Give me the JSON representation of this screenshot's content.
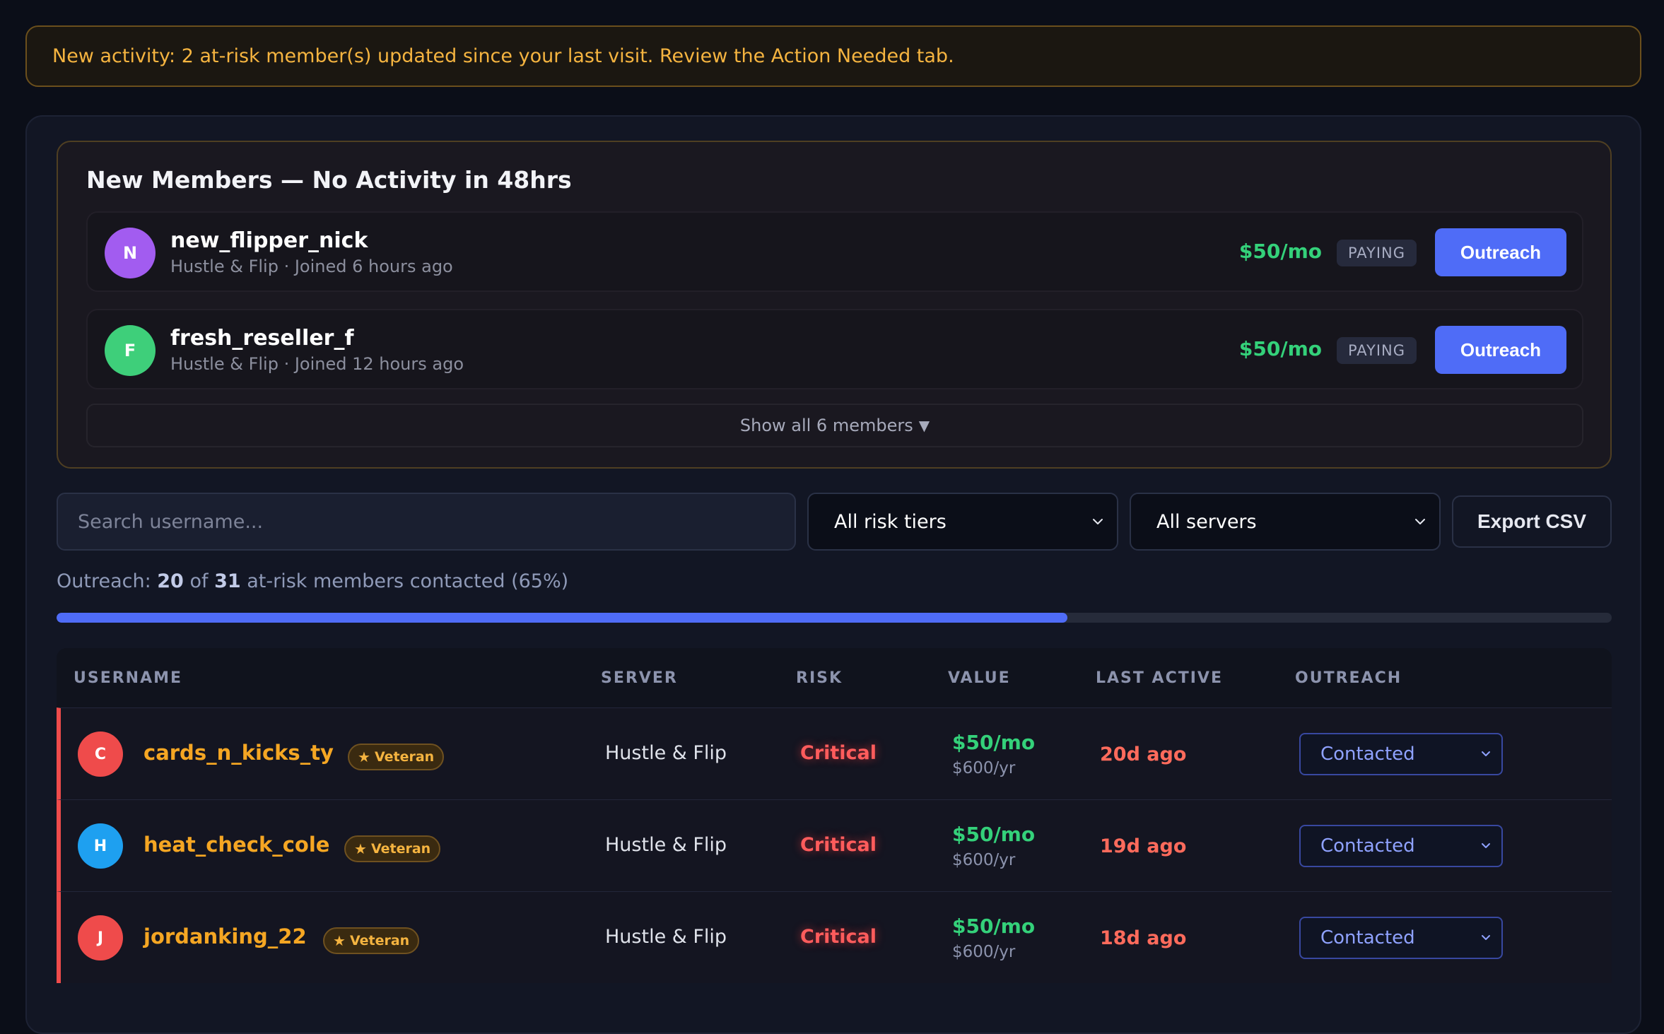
{
  "banner": {
    "text": "New activity: 2 at-risk member(s) updated since your last visit. Review the Action Needed tab."
  },
  "new_members": {
    "title": "New Members — No Activity in 48hrs",
    "members": [
      {
        "initial": "N",
        "avatar_color": "#a25cf0",
        "name": "new_flipper_nick",
        "sub": "Hustle & Flip · Joined 6 hours ago",
        "price": "$50/mo",
        "badge": "PAYING",
        "button": "Outreach"
      },
      {
        "initial": "F",
        "avatar_color": "#3ecf7a",
        "name": "fresh_reseller_f",
        "sub": "Hustle & Flip · Joined 12 hours ago",
        "price": "$50/mo",
        "badge": "PAYING",
        "button": "Outreach"
      }
    ],
    "show_all": "Show all 6 members",
    "show_all_caret": "▼"
  },
  "filters": {
    "search_placeholder": "Search username...",
    "risk_tier": "All risk tiers",
    "server": "All servers",
    "export": "Export CSV"
  },
  "outreach": {
    "prefix": "Outreach:",
    "contacted": "20",
    "of": "of",
    "total": "31",
    "suffix": "at-risk members contacted (65%)",
    "progress_percent": 65
  },
  "table": {
    "headers": {
      "username": "USERNAME",
      "server": "SERVER",
      "risk": "RISK",
      "value": "VALUE",
      "last_active": "LAST ACTIVE",
      "outreach": "OUTREACH"
    },
    "rows": [
      {
        "initial": "C",
        "avatar_color": "#ef4b4b",
        "username": "cards_n_kicks_ty",
        "badge": "Veteran",
        "server": "Hustle & Flip",
        "risk": "Critical",
        "value": "$50/mo",
        "value_yr": "$600/yr",
        "last_active": "20d ago",
        "outreach": "Contacted"
      },
      {
        "initial": "H",
        "avatar_color": "#1ea0f0",
        "username": "heat_check_cole",
        "badge": "Veteran",
        "server": "Hustle & Flip",
        "risk": "Critical",
        "value": "$50/mo",
        "value_yr": "$600/yr",
        "last_active": "19d ago",
        "outreach": "Contacted"
      },
      {
        "initial": "J",
        "avatar_color": "#ef4b4b",
        "username": "jordanking_22",
        "badge": "Veteran",
        "server": "Hustle & Flip",
        "risk": "Critical",
        "value": "$50/mo",
        "value_yr": "$600/yr",
        "last_active": "18d ago",
        "outreach": "Contacted"
      }
    ]
  }
}
